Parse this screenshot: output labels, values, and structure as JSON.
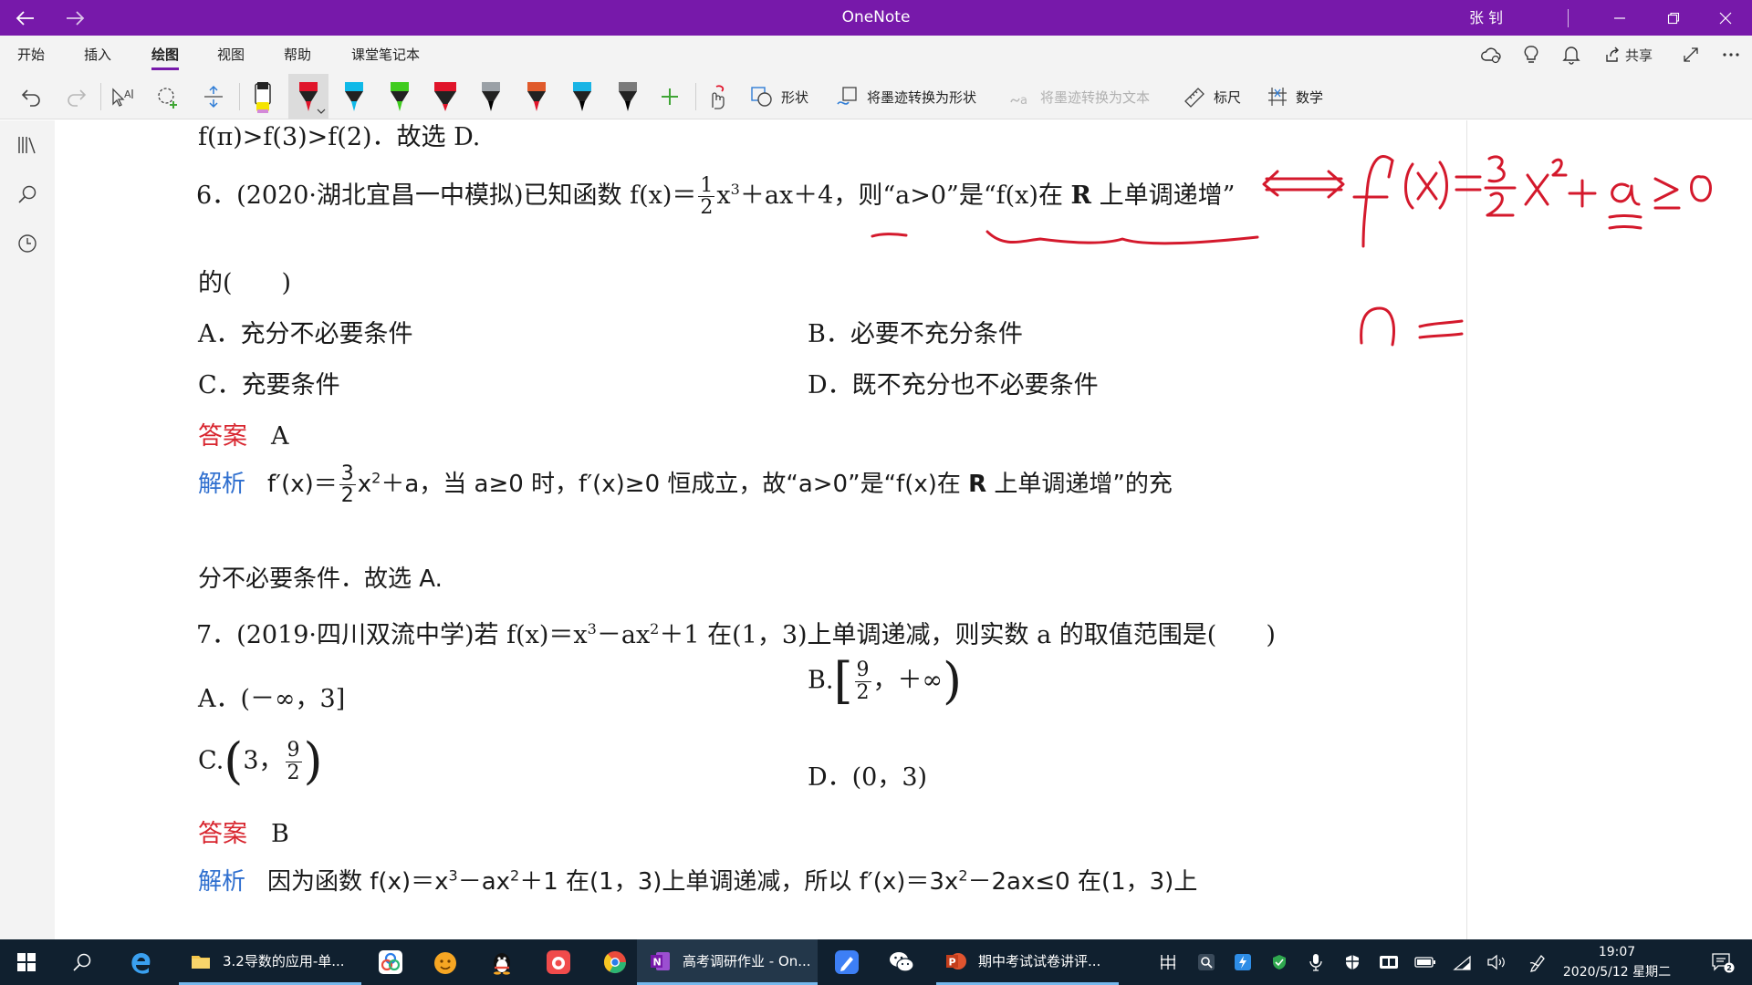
{
  "titlebar": {
    "title": "OneNote",
    "user": "张 钊"
  },
  "ribbon": {
    "tabs": [
      "开始",
      "插入",
      "绘图",
      "视图",
      "帮助",
      "课堂笔记本"
    ],
    "active_tab": "绘图",
    "share_label": "共享"
  },
  "toolbar": {
    "shapes_label": "形状",
    "ink_to_shape_label": "将墨迹转换为形状",
    "ink_to_text_label": "将墨迹转换为文本",
    "ruler_label": "标尺",
    "math_label": "数学",
    "pens": [
      {
        "name": "highlighter-yellow",
        "color": "#f5e400",
        "tip": "#f5e400"
      },
      {
        "name": "pen-red-selected",
        "color": "#e0142a",
        "tip": "#e0142a"
      },
      {
        "name": "pen-cyan",
        "color": "#0fb9e8",
        "tip": "#0fb9e8"
      },
      {
        "name": "pen-green",
        "color": "#3fcc1e",
        "tip": "#3fcc1e"
      },
      {
        "name": "marker-red",
        "color": "#e0142a",
        "tip": "#e0142a"
      },
      {
        "name": "pen-silver",
        "color": "#9aa0a6",
        "tip": "#000000"
      },
      {
        "name": "pen-rainbow",
        "color": "#e05a2b",
        "tip": "#e0142a"
      },
      {
        "name": "pen-cyan-2",
        "color": "#19b4e5",
        "tip": "#000000"
      },
      {
        "name": "pen-galaxy",
        "color": "#7a7a7a",
        "tip": "#000000"
      }
    ],
    "accent_color": "#7719aa"
  },
  "doc": {
    "line0": "f(π)>f(3)>f(2)．故选 D.",
    "q6": {
      "prefix": "6．(2020·",
      "source": "湖北宜昌一中模拟",
      "mid1": ")已知函数 f(x)＝",
      "frac_num": "1",
      "frac_den": "2",
      "x3": "x",
      "exp3": "3",
      "mid2": "＋ax＋4，则“a>0”是“f(x)在 ",
      "R": "R",
      "mid3": " 上单调递增”",
      "cont": "的(　　)",
      "optA": "A．充分不必要条件",
      "optB": "B．必要不充分条件",
      "optC": "C．充要条件",
      "optD": "D．既不充分也不必要条件",
      "answer_label": "答案",
      "answer": "A",
      "analysis_label": "解析",
      "an_pre": "f′(x)＝",
      "an_num": "3",
      "an_den": "2",
      "an_x": "x",
      "an_exp": "2",
      "an_post1": "＋a，当 a≥0 时，f′(x)≥0 恒成立，故“a>0”是“f(x)在 ",
      "an_R": "R",
      "an_post2": " 上单调递增”的充",
      "an_line2": "分不必要条件．故选 A."
    },
    "q7": {
      "prefix": "7．(2019·",
      "source": "四川双流中学",
      "mid1": ")若 f(x)＝x",
      "exp3": "3",
      "mid2": "－ax",
      "exp2": "2",
      "mid3": "＋1 在(1，3)上单调递减，则实数 a 的取值范围是(　　)",
      "optA": "A．(－∞，3]",
      "optB_pre": "B.",
      "optB_num": "9",
      "optB_den": "2",
      "optB_post": "，＋∞",
      "optC_pre": "C.",
      "optC_a": "3，",
      "optC_num": "9",
      "optC_den": "2",
      "optD": "D．(0，3)",
      "answer_label": "答案",
      "answer": "B",
      "analysis_label": "解析",
      "an_pre": "因为函数 f(x)＝x",
      "an_e3": "3",
      "an_m1": "－ax",
      "an_e2": "2",
      "an_m2": "＋1 在(1，3)上单调递减，所以 f′(x)＝3x",
      "an_e2b": "2",
      "an_m3": "－2ax≤0 在(1，3)上"
    }
  },
  "ink_color": "#d4192c",
  "taskbar": {
    "items": [
      {
        "label": "3.2导数的应用-单..."
      },
      {
        "label": "高考调研作业 - On..."
      },
      {
        "label": "期中考试试卷讲评..."
      }
    ],
    "time": "19:07",
    "date": "2020/5/12 星期二",
    "notification_count": "2"
  }
}
